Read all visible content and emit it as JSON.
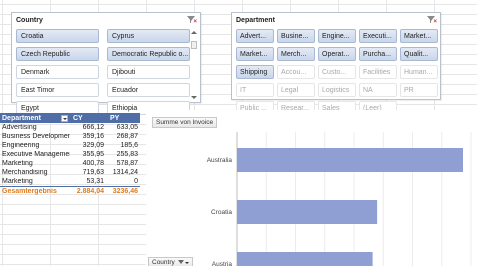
{
  "country_slicer": {
    "title": "Country",
    "items": [
      {
        "label": "Croatia",
        "state": "selected"
      },
      {
        "label": "Cyprus",
        "state": "selected"
      },
      {
        "label": "Czech Republic",
        "state": "selected"
      },
      {
        "label": "Democratic Republic o...",
        "state": "selected"
      },
      {
        "label": "Denmark",
        "state": "normal"
      },
      {
        "label": "Djibouti",
        "state": "normal"
      },
      {
        "label": "East Timor",
        "state": "normal"
      },
      {
        "label": "Ecuador",
        "state": "normal"
      },
      {
        "label": "Egypt",
        "state": "normal"
      },
      {
        "label": "Ethiopia",
        "state": "normal"
      }
    ]
  },
  "department_slicer": {
    "title": "Department",
    "items": [
      {
        "label": "Advert...",
        "state": "selected"
      },
      {
        "label": "Busine...",
        "state": "selected"
      },
      {
        "label": "Engine...",
        "state": "selected"
      },
      {
        "label": "Executi...",
        "state": "selected"
      },
      {
        "label": "Market...",
        "state": "selected"
      },
      {
        "label": "Market...",
        "state": "selected"
      },
      {
        "label": "Merch...",
        "state": "selected"
      },
      {
        "label": "Operat...",
        "state": "selected"
      },
      {
        "label": "Purcha...",
        "state": "selected"
      },
      {
        "label": "Qualit...",
        "state": "selected"
      },
      {
        "label": "Shipping",
        "state": "selected"
      },
      {
        "label": "Accou...",
        "state": "disabled"
      },
      {
        "label": "Custo...",
        "state": "disabled"
      },
      {
        "label": "Facilities",
        "state": "disabled"
      },
      {
        "label": "Human...",
        "state": "disabled"
      },
      {
        "label": "IT",
        "state": "disabled"
      },
      {
        "label": "Legal",
        "state": "disabled"
      },
      {
        "label": "Logistics",
        "state": "disabled"
      },
      {
        "label": "NA",
        "state": "disabled"
      },
      {
        "label": "PR",
        "state": "disabled"
      },
      {
        "label": "Public ...",
        "state": "disabled"
      },
      {
        "label": "Resear...",
        "state": "disabled"
      },
      {
        "label": "Sales",
        "state": "disabled"
      },
      {
        "label": "(Leer)",
        "state": "disabled"
      }
    ]
  },
  "pivot": {
    "headers": [
      "Department",
      "CY",
      "PY"
    ],
    "rows": [
      [
        "Advertising",
        "666,12",
        "633,05"
      ],
      [
        "Business Development",
        "359,16",
        "268,87"
      ],
      [
        "Engineering",
        "329,09",
        "185,6"
      ],
      [
        "Executive Management",
        "355,95",
        "255,83"
      ],
      [
        "Marketing",
        "400,78",
        "578,87"
      ],
      [
        "Merchandising",
        "719,63",
        "1314,24"
      ],
      [
        "Marketing",
        "53,31",
        "0"
      ]
    ],
    "total": [
      "Gesamtergebnis",
      "2.884,04",
      "3236,46"
    ]
  },
  "chart": {
    "field_value_button": "Summe von Invoice",
    "field_axis_button": "Country"
  },
  "chart_data": {
    "type": "bar",
    "orientation": "horizontal",
    "categories": [
      "Australia",
      "Croatia",
      "Austria"
    ],
    "values": [
      1.0,
      0.62,
      0.6
    ],
    "bar_color": "#8f9fd3",
    "grid": true
  },
  "colors": {
    "pivot_header": "#4f6ea8",
    "total_text": "#e07b1f",
    "selected_button": "#c9d6ea"
  }
}
